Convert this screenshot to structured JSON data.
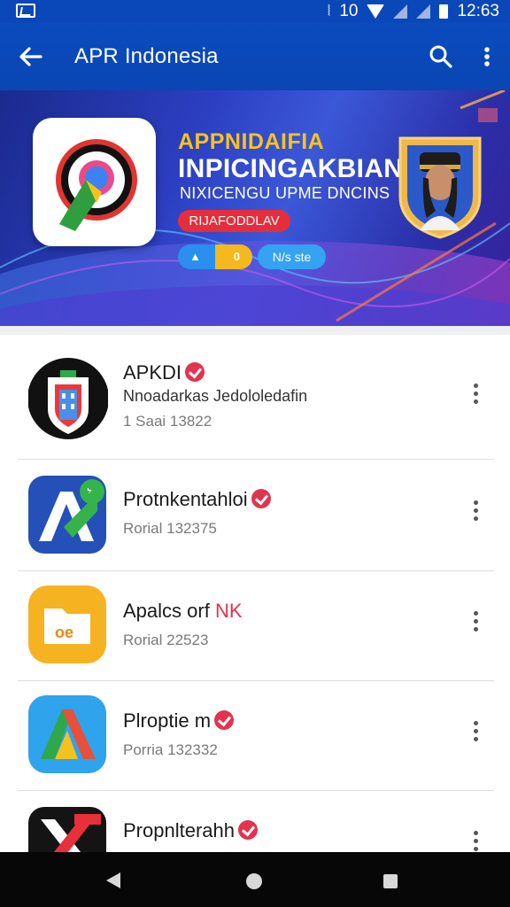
{
  "status_bar": {
    "network_label": "10",
    "time": "12:63",
    "icons": [
      "gallery-icon",
      "vibrate-icon",
      "wifi-icon",
      "cell-signal-icon",
      "battery-icon"
    ]
  },
  "app_bar": {
    "title": "APR Indonesia",
    "icons": [
      "back-arrow-icon",
      "search-icon",
      "more-vert-icon"
    ]
  },
  "banner": {
    "heading": "APPNIDAIFIA",
    "title": "INPICINGAKBIAN",
    "subtitle": "NIXICENGU UPME DNCINS",
    "cta_label": "RIJAFODDLAV",
    "pill_left_icon": "▲",
    "pill_right_icon": "0",
    "pill_label": "N/s ste",
    "colors": {
      "heading": "#f6c31c",
      "cta": "#e52d3b",
      "background": "#2c3fc2"
    }
  },
  "apps": [
    {
      "name": "APKDI",
      "verified": true,
      "description": "Nnoadarkas Jedololedafin",
      "meta": "1 Saai 13822",
      "icon": "shield-building-app-icon"
    },
    {
      "name": "Protnkentahloi",
      "verified": true,
      "description": "",
      "meta": "Rorial 132375",
      "icon": "letter-a-app-icon"
    },
    {
      "name": "Apalcs orf",
      "name_suffix": "NK",
      "verified": false,
      "description": "",
      "meta": "Rorial 22523",
      "icon": "folder-app-icon"
    },
    {
      "name": "Plroptie m",
      "verified": true,
      "description": "",
      "meta": "Porria 132332",
      "icon": "triangle-app-icon"
    },
    {
      "name": "Propnlterahh",
      "verified": true,
      "description": "",
      "meta": "",
      "icon": "x-app-icon"
    }
  ],
  "nav_bar": {
    "icons": [
      "nav-back-icon",
      "nav-home-icon",
      "nav-recents-icon"
    ]
  }
}
